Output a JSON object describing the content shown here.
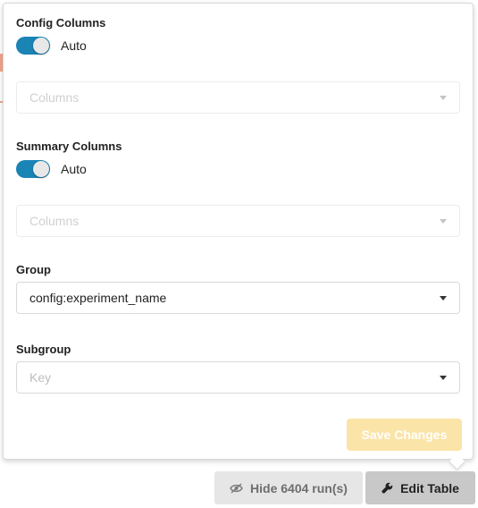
{
  "panel": {
    "config_columns": {
      "title": "Config Columns",
      "toggle_label": "Auto",
      "toggle_on": true,
      "select_placeholder": "Columns"
    },
    "summary_columns": {
      "title": "Summary Columns",
      "toggle_label": "Auto",
      "toggle_on": true,
      "select_placeholder": "Columns"
    },
    "group": {
      "title": "Group",
      "value": "config:experiment_name"
    },
    "subgroup": {
      "title": "Subgroup",
      "placeholder": "Key"
    },
    "save_button": "Save Changes"
  },
  "footer": {
    "hide_runs_label": "Hide 6404 run(s)",
    "hide_runs_icon": "eye-slash-icon",
    "edit_table_label": "Edit Table",
    "edit_table_icon": "wrench-icon"
  },
  "colors": {
    "toggle_active": "#1a84b5",
    "save_button_disabled": "#fbe4a8"
  }
}
